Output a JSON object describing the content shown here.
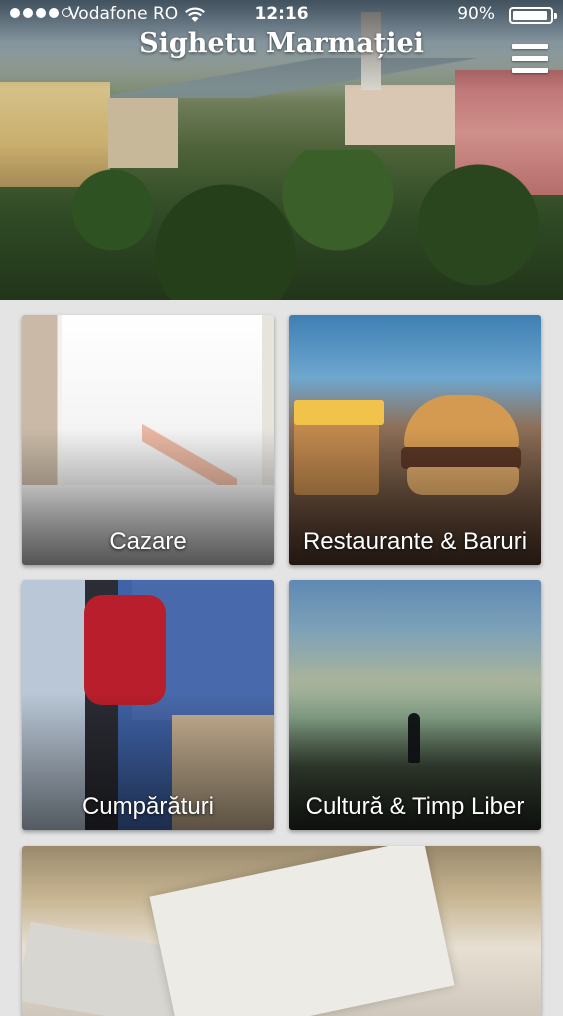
{
  "status_bar": {
    "carrier": "Vodafone RO",
    "signal_bars": 4,
    "signal_max": 5,
    "time": "12:16",
    "battery_percent": "90%",
    "battery_level": 0.9
  },
  "header": {
    "title": "Sighetu Marmației",
    "menu_icon": "hamburger-menu-icon"
  },
  "tiles": [
    {
      "label": "Cazare"
    },
    {
      "label": "Restaurante & Baruri"
    },
    {
      "label": "Cumpărături"
    },
    {
      "label": "Cultură & Timp Liber"
    }
  ],
  "colors": {
    "background": "#e4e4e4",
    "text": "#ffffff"
  }
}
